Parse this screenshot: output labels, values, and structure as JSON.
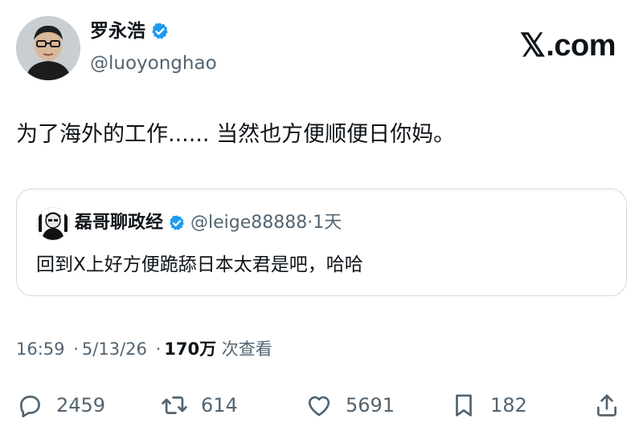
{
  "author": {
    "name": "罗永浩",
    "handle": "@luoyonghao"
  },
  "brand": {
    "logo_letter": "𝕏",
    "logo_suffix": ".com"
  },
  "tweet": {
    "text": "为了海外的工作...... 当然也方便顺便日你妈。"
  },
  "quote": {
    "name": "磊哥聊政经",
    "handle": "@leige88888",
    "separator": "·",
    "age": "1天",
    "text": "回到X上好方便跪舔日本太君是吧，哈哈"
  },
  "meta": {
    "time": "16:59",
    "date": "5/13/26",
    "views_count": "170万",
    "views_label": "次查看"
  },
  "actions": {
    "replies": "2459",
    "retweets": "614",
    "likes": "5691",
    "bookmarks": "182"
  },
  "colors": {
    "verified": "#1d9bf0",
    "text_primary": "#0f1419",
    "text_secondary": "#536471",
    "border": "#cfd9de"
  }
}
